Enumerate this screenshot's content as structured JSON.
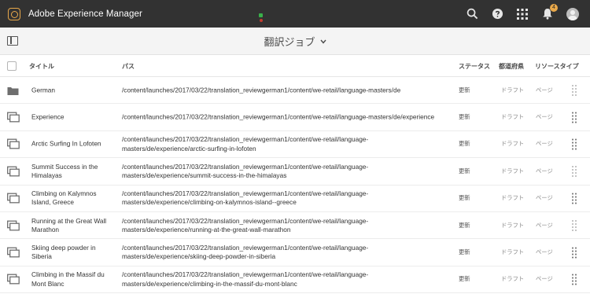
{
  "app": {
    "title": "Adobe Experience Manager",
    "notification_count": "4"
  },
  "header": {
    "page_title": "翻訳ジョブ"
  },
  "table": {
    "columns": {
      "title": "タイトル",
      "path": "パス",
      "status": "ステータス",
      "prefecture": "都道府県",
      "resource_type": "リソースタイプ"
    },
    "rows": [
      {
        "icon": "folder-icon",
        "title": "German",
        "path": "/content/launches/2017/03/22/translation_reviewgerman1/content/we-retail/language-masters/de",
        "status": "更新",
        "prefecture": "ドラフト",
        "resource_type": "ページ"
      },
      {
        "icon": "pages-icon",
        "title": "Experience",
        "path": "/content/launches/2017/03/22/translation_reviewgerman1/content/we-retail/language-masters/de/experience",
        "status": "更新",
        "prefecture": "ドラフト",
        "resource_type": "ページ"
      },
      {
        "icon": "pages-icon",
        "title": "Arctic Surfing In Lofoten",
        "path": "/content/launches/2017/03/22/translation_reviewgerman1/content/we-retail/language-masters/de/experience/arctic-surfing-in-lofoten",
        "status": "更新",
        "prefecture": "ドラフト",
        "resource_type": "ページ"
      },
      {
        "icon": "pages-icon",
        "title": "Summit Success in the Himalayas",
        "path": "/content/launches/2017/03/22/translation_reviewgerman1/content/we-retail/language-masters/de/experience/summit-success-in-the-himalayas",
        "status": "更新",
        "prefecture": "ドラフト",
        "resource_type": "ページ"
      },
      {
        "icon": "pages-icon",
        "title": "Climbing on Kalymnos Island, Greece",
        "path": "/content/launches/2017/03/22/translation_reviewgerman1/content/we-retail/language-masters/de/experience/climbing-on-kalymnos-island--greece",
        "status": "更新",
        "prefecture": "ドラフト",
        "resource_type": "ページ"
      },
      {
        "icon": "pages-icon",
        "title": "Running at the Great Wall Marathon",
        "path": "/content/launches/2017/03/22/translation_reviewgerman1/content/we-retail/language-masters/de/experience/running-at-the-great-wall-marathon",
        "status": "更新",
        "prefecture": "ドラフト",
        "resource_type": "ページ"
      },
      {
        "icon": "pages-icon",
        "title": "Skiing deep powder in Siberia",
        "path": "/content/launches/2017/03/22/translation_reviewgerman1/content/we-retail/language-masters/de/experience/skiing-deep-powder-in-siberia",
        "status": "更新",
        "prefecture": "ドラフト",
        "resource_type": "ページ"
      },
      {
        "icon": "pages-icon",
        "title": "Climbing in the Massif du Mont Blanc",
        "path": "/content/launches/2017/03/22/translation_reviewgerman1/content/we-retail/language-masters/de/experience/climbing-in-the-massif-du-mont-blanc",
        "status": "更新",
        "prefecture": "ドラフト",
        "resource_type": "ページ"
      }
    ]
  },
  "colors": {
    "topbar": "#323232",
    "logo_accent": "#e8a84a",
    "actionbar": "#f4f4f4"
  }
}
